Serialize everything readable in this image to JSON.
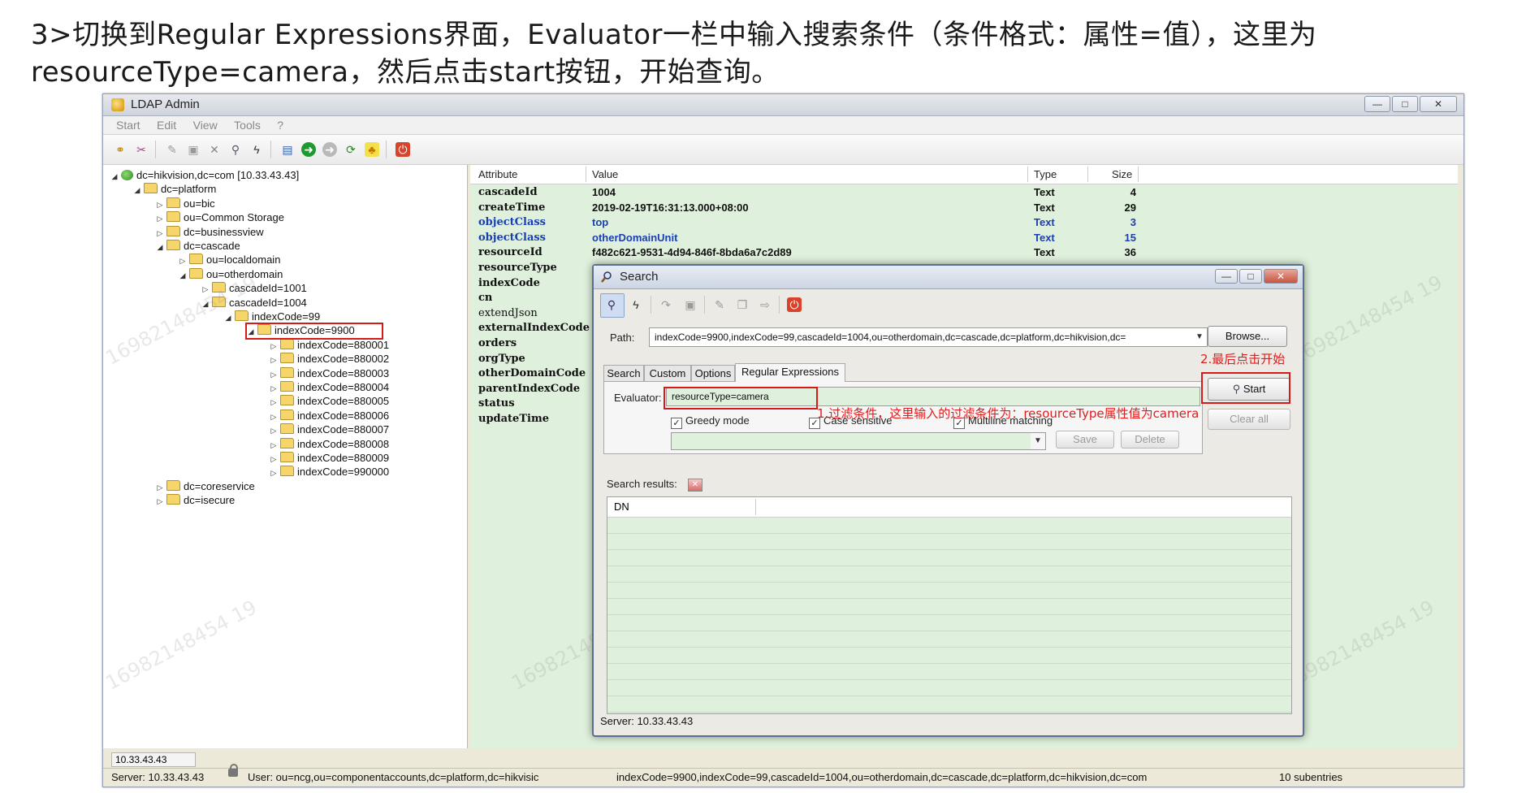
{
  "instruction": {
    "line1": "3>切换到Regular Expressions界面，Evaluator一栏中输入搜索条件（条件格式：属性=值），这里为",
    "line2": "resourceType=camera，然后点击start按钮，开始查询。"
  },
  "window": {
    "title": "LDAP Admin",
    "minimize": "—",
    "maximize": "□",
    "close": "✕"
  },
  "menu": [
    "Start",
    "Edit",
    "View",
    "Tools",
    "?"
  ],
  "toolbar_icons": [
    "connect-icon",
    "disconnect-icon",
    "edit-icon",
    "save-icon",
    "delete-icon",
    "search-icon",
    "lightning-icon",
    "book-icon",
    "forward-green-icon",
    "back-grey-icon",
    "refresh-icon",
    "tree-icon",
    "exit-icon"
  ],
  "tree": [
    {
      "label": "dc=hikvision,dc=com [10.33.43.43]",
      "level": 0,
      "expanded": true,
      "root": true
    },
    {
      "label": "dc=platform",
      "level": 1,
      "expanded": true
    },
    {
      "label": "ou=bic",
      "level": 2,
      "expanded": false
    },
    {
      "label": "ou=Common Storage",
      "level": 2,
      "expanded": false
    },
    {
      "label": "dc=businessview",
      "level": 2,
      "expanded": false
    },
    {
      "label": "dc=cascade",
      "level": 2,
      "expanded": true
    },
    {
      "label": "ou=localdomain",
      "level": 3,
      "expanded": false
    },
    {
      "label": "ou=otherdomain",
      "level": 3,
      "expanded": true
    },
    {
      "label": "cascadeId=1001",
      "level": 4,
      "expanded": false
    },
    {
      "label": "cascadeId=1004",
      "level": 4,
      "expanded": true
    },
    {
      "label": "indexCode=99",
      "level": 5,
      "expanded": true
    },
    {
      "label": "indexCode=9900",
      "level": 6,
      "expanded": true,
      "selected": true
    },
    {
      "label": "indexCode=880001",
      "level": 7,
      "expanded": false
    },
    {
      "label": "indexCode=880002",
      "level": 7,
      "expanded": false
    },
    {
      "label": "indexCode=880003",
      "level": 7,
      "expanded": false
    },
    {
      "label": "indexCode=880004",
      "level": 7,
      "expanded": false
    },
    {
      "label": "indexCode=880005",
      "level": 7,
      "expanded": false
    },
    {
      "label": "indexCode=880006",
      "level": 7,
      "expanded": false
    },
    {
      "label": "indexCode=880007",
      "level": 7,
      "expanded": false
    },
    {
      "label": "indexCode=880008",
      "level": 7,
      "expanded": false
    },
    {
      "label": "indexCode=880009",
      "level": 7,
      "expanded": false
    },
    {
      "label": "indexCode=990000",
      "level": 7,
      "expanded": false
    },
    {
      "label": "dc=coreservice",
      "level": 2,
      "expanded": false
    },
    {
      "label": "dc=isecure",
      "level": 2,
      "expanded": false
    }
  ],
  "attributes": {
    "headers": {
      "attribute": "Attribute",
      "value": "Value",
      "type": "Type",
      "size": "Size"
    },
    "rows": [
      {
        "name": "cascadeId",
        "value": "1004",
        "type": "Text",
        "size": "4",
        "blue": false
      },
      {
        "name": "createTime",
        "value": "2019-02-19T16:31:13.000+08:00",
        "type": "Text",
        "size": "29",
        "blue": false
      },
      {
        "name": "objectClass",
        "value": "top",
        "type": "Text",
        "size": "3",
        "blue": true
      },
      {
        "name": "objectClass",
        "value": "otherDomainUnit",
        "type": "Text",
        "size": "15",
        "blue": true
      },
      {
        "name": "resourceId",
        "value": "f482c621-9531-4d94-846f-8bda6a7c2d89",
        "type": "Text",
        "size": "36",
        "blue": false
      },
      {
        "name": "resourceType",
        "value": "",
        "type": "",
        "size": "",
        "blue": false
      },
      {
        "name": "indexCode",
        "value": "",
        "type": "",
        "size": "",
        "blue": false
      },
      {
        "name": "cn",
        "value": "",
        "type": "",
        "size": "",
        "blue": false
      },
      {
        "name": "extendJson",
        "value": "",
        "type": "",
        "size": "",
        "blue": false,
        "plain": true
      },
      {
        "name": "externalIndexCode",
        "value": "",
        "type": "",
        "size": "",
        "blue": false
      },
      {
        "name": "orders",
        "value": "",
        "type": "",
        "size": "",
        "blue": false
      },
      {
        "name": "orgType",
        "value": "",
        "type": "",
        "size": "",
        "blue": false
      },
      {
        "name": "otherDomainCode",
        "value": "",
        "type": "",
        "size": "",
        "blue": false
      },
      {
        "name": "parentIndexCode",
        "value": "",
        "type": "",
        "size": "",
        "blue": false
      },
      {
        "name": "status",
        "value": "",
        "type": "",
        "size": "",
        "blue": false
      },
      {
        "name": "updateTime",
        "value": "",
        "type": "",
        "size": "",
        "blue": false
      }
    ]
  },
  "status": {
    "server_cell": "10.33.43.43",
    "server": "Server: 10.33.43.43",
    "user": "User: ou=ncg,ou=componentaccounts,dc=platform,dc=hikvisic",
    "path": "indexCode=9900,indexCode=99,cascadeId=1004,ou=otherdomain,dc=cascade,dc=platform,dc=hikvision,dc=com",
    "subentries": "10 subentries"
  },
  "search_dialog": {
    "title": "Search",
    "path_label": "Path:",
    "path_value": "indexCode=9900,indexCode=99,cascadeId=1004,ou=otherdomain,dc=cascade,dc=platform,dc=hikvision,dc=",
    "browse": "Browse...",
    "tabs": [
      "Search",
      "Custom",
      "Options",
      "Regular Expressions"
    ],
    "active_tab": "Regular Expressions",
    "evaluator_label": "Evaluator:",
    "evaluator_value": "resourceType=camera",
    "checkboxes": [
      {
        "label": "Greedy mode",
        "checked": true
      },
      {
        "label": "Case sensitive",
        "checked": true
      },
      {
        "label": "Multiline matching",
        "checked": true
      }
    ],
    "start": "Start",
    "clear_all": "Clear all",
    "save": "Save",
    "delete": "Delete",
    "results_label": "Search results:",
    "results_close": "✕",
    "dn_header": "DN",
    "status": "Server: 10.33.43.43"
  },
  "annotations": {
    "start_note": "2.最后点击开始",
    "filter_note": "1.过滤条件，这里输入的过滤条件为：resourceType属性值为camera"
  },
  "watermark": "16982148454 19"
}
